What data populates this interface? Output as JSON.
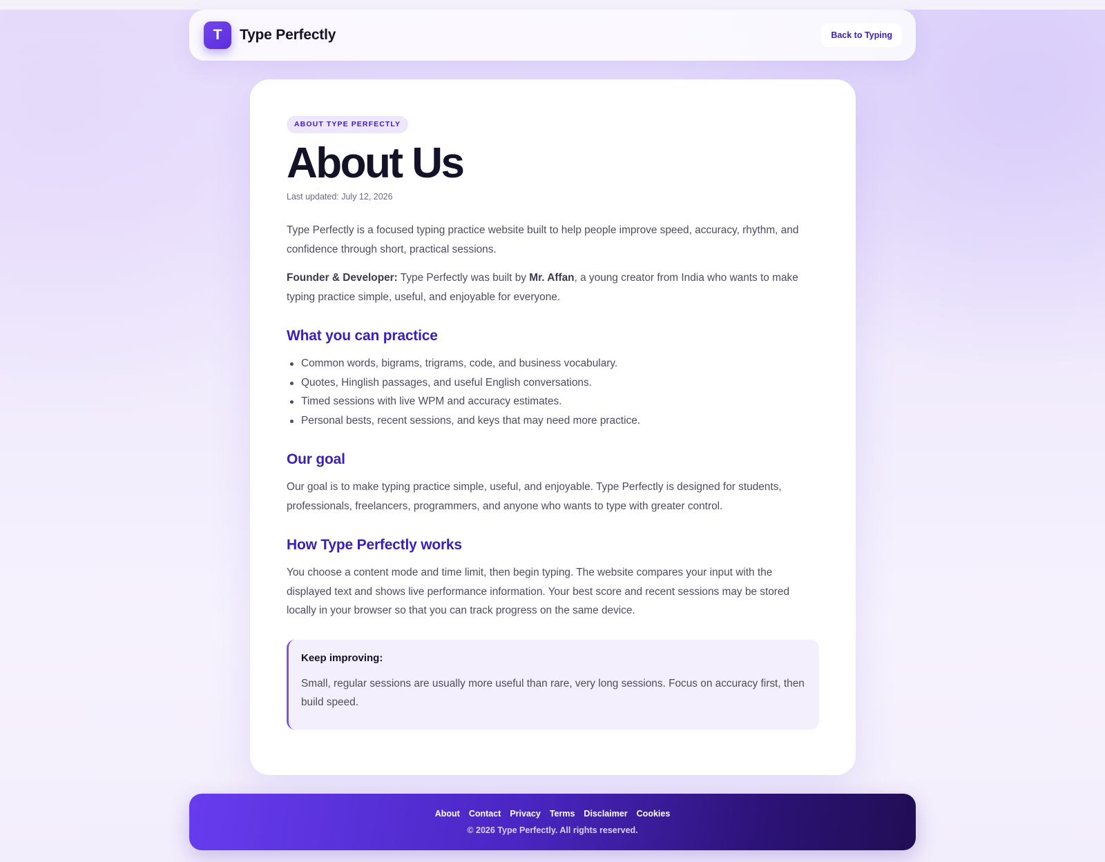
{
  "header": {
    "logo_letter": "T",
    "brand_name": "Type Perfectly",
    "back_button": "Back to Typing"
  },
  "article": {
    "eyebrow": "ABOUT TYPE PERFECTLY",
    "title": "About Us",
    "last_updated": "Last updated: July 12, 2026",
    "intro": "Type Perfectly is a focused typing practice website built to help people improve speed, accuracy, rhythm, and confidence through short, practical sessions.",
    "founder": {
      "label": "Founder & Developer:",
      "text_before": " Type Perfectly was built by ",
      "name": "Mr. Affan",
      "text_after": ", a young creator from India who wants to make typing practice simple, useful, and enjoyable for everyone."
    },
    "practice": {
      "heading": "What you can practice",
      "items": [
        "Common words, bigrams, trigrams, code, and business vocabulary.",
        "Quotes, Hinglish passages, and useful English conversations.",
        "Timed sessions with live WPM and accuracy estimates.",
        "Personal bests, recent sessions, and keys that may need more practice."
      ]
    },
    "goal": {
      "heading": "Our goal",
      "text": "Our goal is to make typing practice simple, useful, and enjoyable. Type Perfectly is designed for students, professionals, freelancers, programmers, and anyone who wants to type with greater control."
    },
    "how": {
      "heading": "How Type Perfectly works",
      "text": "You choose a content mode and time limit, then begin typing. The website compares your input with the displayed text and shows live performance information. Your best score and recent sessions may be stored locally in your browser so that you can track progress on the same device."
    },
    "callout": {
      "title": "Keep improving:",
      "text": "Small, regular sessions are usually more useful than rare, very long sessions. Focus on accuracy first, then build speed."
    }
  },
  "footer": {
    "links": [
      "About",
      "Contact",
      "Privacy",
      "Terms",
      "Disclaimer",
      "Cookies"
    ],
    "copyright": "© 2026 Type Perfectly. All rights reserved."
  },
  "colors": {
    "accent": "#6a3ff0",
    "heading": "#3a1fb3",
    "text": "#4e4b5e",
    "dark": "#141227"
  }
}
